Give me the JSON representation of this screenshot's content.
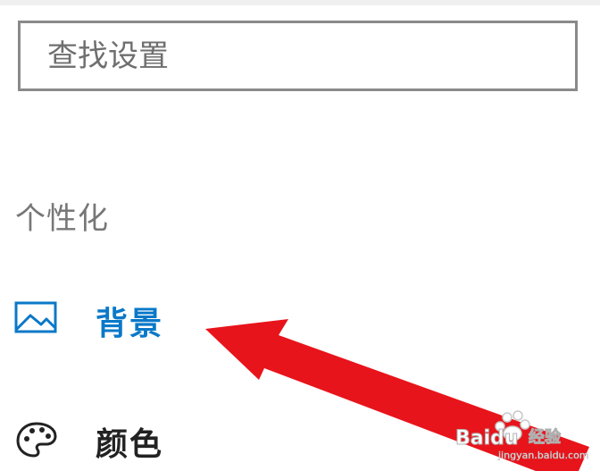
{
  "search": {
    "placeholder": "查找设置",
    "value": ""
  },
  "section": {
    "title": "个性化"
  },
  "nav": {
    "items": [
      {
        "label": "背景",
        "icon": "picture-icon",
        "selected": true
      },
      {
        "label": "颜色",
        "icon": "palette-icon",
        "selected": false
      }
    ]
  },
  "colors": {
    "accent": "#0a78c8",
    "annotation_arrow": "#e8141b"
  },
  "watermark": {
    "brand": "Baidu",
    "sub": "经验",
    "url": "jingyan.baidu.com"
  }
}
